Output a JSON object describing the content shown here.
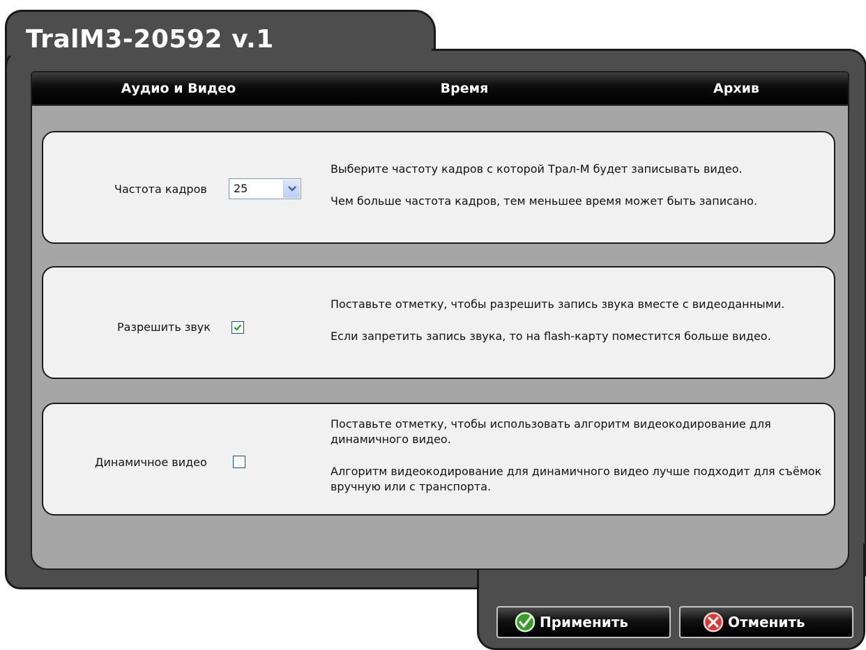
{
  "window": {
    "title": "TralM3-20592 v.1"
  },
  "tabs": [
    {
      "label": "Аудио и Видео",
      "active": true
    },
    {
      "label": "Время",
      "active": false
    },
    {
      "label": "Архив",
      "active": false
    }
  ],
  "settings": {
    "frame_rate": {
      "label": "Частота кадров",
      "value": "25",
      "desc1": "Выберите частоту кадров с которой Трал-М будет записывать видео.",
      "desc2": "Чем больше частота кадров, тем меньшее время может быть записано."
    },
    "sound": {
      "label": "Разрешить звук",
      "checked": true,
      "desc1": "Поставьте отметку, чтобы разрешить запись звука вместе с видеоданными.",
      "desc2": "Если запретить запись звука, то на flash-карту поместится больше видео."
    },
    "dynamic_video": {
      "label": "Динамичное видео",
      "checked": false,
      "desc1": "Поставьте отметку, чтобы использовать алгоритм видеокодирование для динамичного видео.",
      "desc2": "Алгоритм видеокодирование для динамичного видео лучше подходит для съёмок вручную или с транспорта."
    }
  },
  "buttons": {
    "apply": "Применить",
    "cancel": "Отменить"
  },
  "colors": {
    "shell": "#4d4d4d",
    "panel": "#a6a6a6",
    "card": "#f1f1f1",
    "apply_icon": "#3a9a2a",
    "cancel_icon": "#d83a3a"
  },
  "icons": {
    "apply": "check-circle-icon",
    "cancel": "cross-circle-icon",
    "dropdown": "chevron-down-icon",
    "checkmark": "checkmark-icon"
  }
}
